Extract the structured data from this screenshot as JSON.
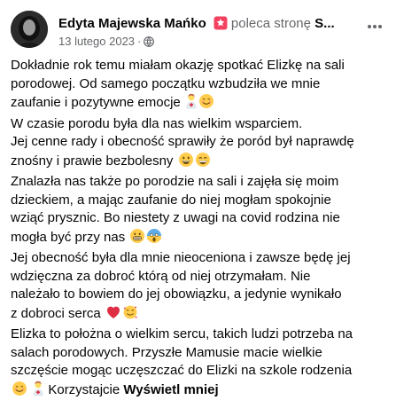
{
  "post": {
    "author": "Edyta Majewska Mańko",
    "recommends_text": "poleca stronę",
    "page_name": "S...",
    "date": "13 lutego 2023",
    "dot": "·",
    "more_label": "···"
  },
  "body": {
    "lines": [
      {
        "text": "Dokładnie rok temu miałam okazję spotkać Elizkę na sali",
        "emoji": []
      },
      {
        "text": "porodowej. Od samego początku wzbudziła we mnie",
        "emoji": []
      },
      {
        "text": "zaufanie i pozytywne emocje",
        "emoji": [
          "woman-health-worker-emoji",
          "smiling-face-emoji"
        ]
      },
      {
        "text": "W czasie porodu była dla nas wielkim wsparciem.",
        "emoji": []
      },
      {
        "text": "Jej cenne rady i obecność sprawiły że poród był naprawdę",
        "emoji": []
      },
      {
        "text": "znośny i prawie bezbolesny",
        "emoji": [
          "grinning-face-emoji",
          "beaming-face-emoji"
        ]
      },
      {
        "text": "Znalazła nas także po porodzie na sali i zajęła się moim",
        "emoji": []
      },
      {
        "text": "dzieckiem, a mając zaufanie do niej mogłam spokojnie",
        "emoji": []
      },
      {
        "text": "wziąć prysznic. Bo niestety z uwagi na covid rodzina nie",
        "emoji": []
      },
      {
        "text": "mogła być przy nas",
        "emoji": [
          "grimacing-face-emoji",
          "screaming-face-emoji"
        ]
      },
      {
        "text": "Jej obecność była dla mnie nieoceniona i zawsze będę jej",
        "emoji": []
      },
      {
        "text": "wdzięczna za dobroć którą od niej otrzymałam. Nie",
        "emoji": []
      },
      {
        "text": "należało to bowiem do jej obowiązku, a jedynie wynikało",
        "emoji": []
      },
      {
        "text": "z dobroci serca",
        "emoji": [
          "red-heart-emoji",
          "smiling-hearts-face-emoji"
        ]
      },
      {
        "text": "Elizka to położna o wielkim sercu, takich ludzi potrzeba na",
        "emoji": []
      },
      {
        "text": "salach porodowych. Przyszłe Mamusie macie wielkie",
        "emoji": []
      },
      {
        "text": "szczęście mogąc uczęszczać do Elizki na szkole rodzenia",
        "emoji": []
      },
      {
        "text": "Korzystajcie",
        "emoji": [],
        "leading_emoji": [
          "smiling-face-emoji",
          "woman-health-worker-emoji"
        ]
      }
    ],
    "see_more": "Wyświetl mniej"
  },
  "colors": {
    "text": "#050505",
    "secondary": "#65676b",
    "recommend_badge": "#f3425f"
  }
}
